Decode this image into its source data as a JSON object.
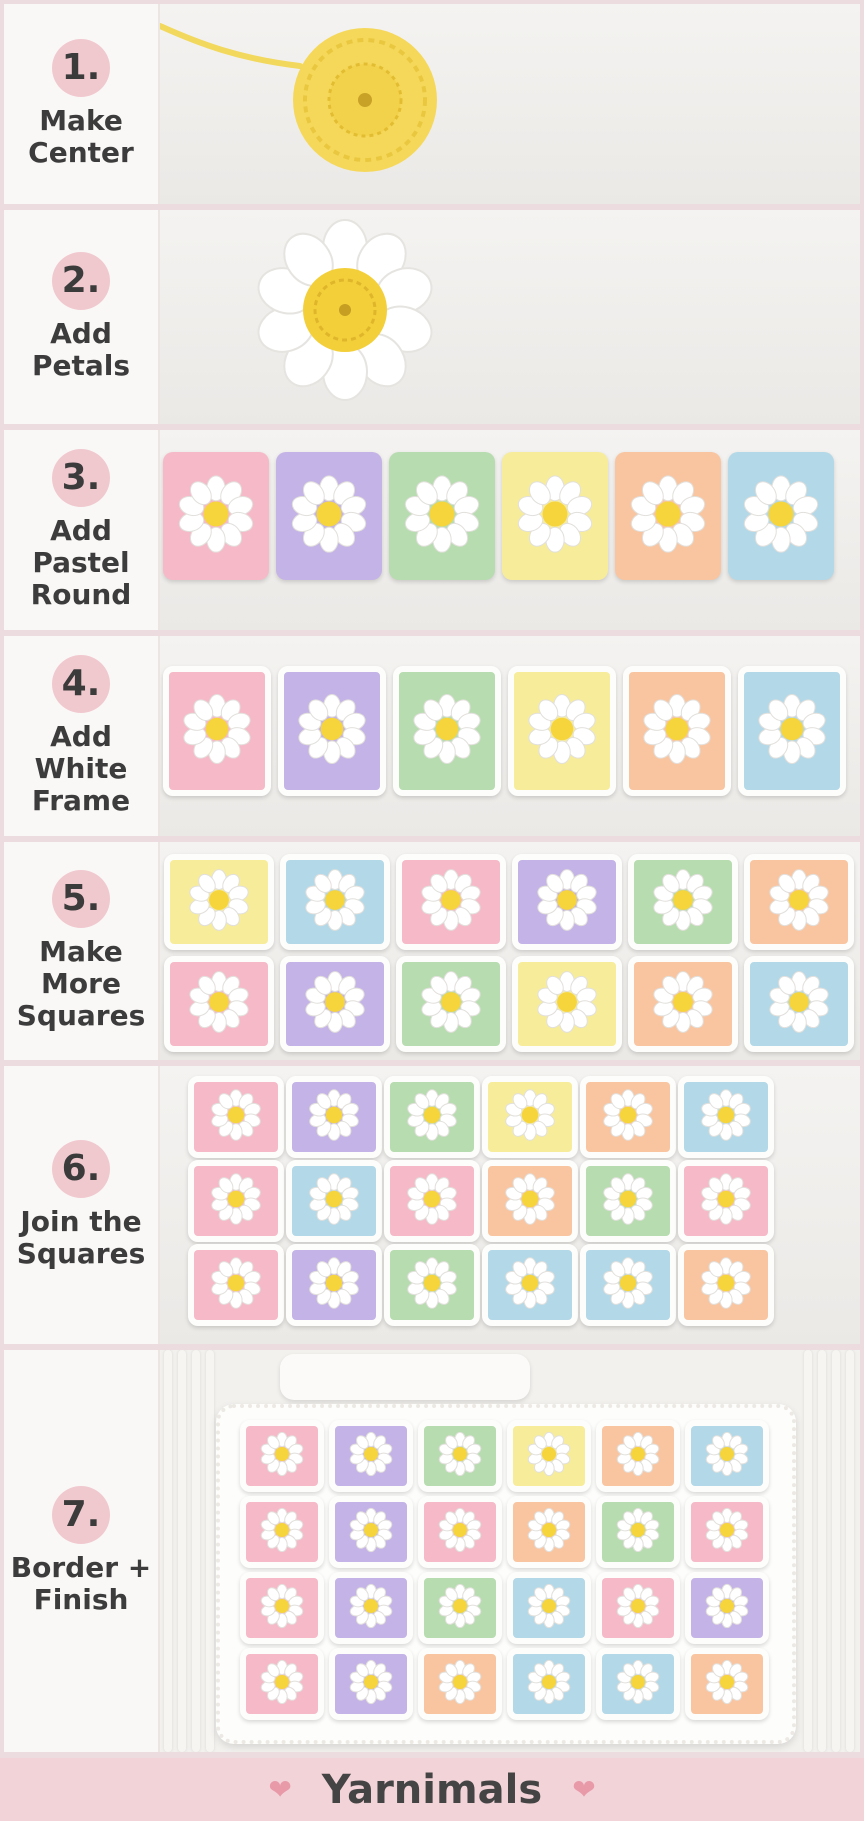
{
  "steps": [
    {
      "number": "1.",
      "title": "Make\nCenter"
    },
    {
      "number": "2.",
      "title": "Add\nPetals"
    },
    {
      "number": "3.",
      "title": "Add\nPastel\nRound"
    },
    {
      "number": "4.",
      "title": "Add\nWhite\nFrame"
    },
    {
      "number": "5.",
      "title": "Make\nMore\nSquares"
    },
    {
      "number": "6.",
      "title": "Join the\nSquares"
    },
    {
      "number": "7.",
      "title": "Border +\nFinish"
    }
  ],
  "brand": "Yarnimals",
  "colors": {
    "pink": "#f6b9c8",
    "lavender": "#c4b3e6",
    "mint": "#b7dcb0",
    "yellow": "#f7ec9a",
    "peach": "#f9c5a0",
    "blue": "#b3d8e8",
    "center": "#f5d43c",
    "petal": "#ffffff",
    "accent": "#f0c9cf"
  },
  "icons": {
    "heart": "heart-icon"
  },
  "rows": {
    "step3": [
      "pink",
      "lavender",
      "mint",
      "yellow",
      "peach",
      "blue"
    ],
    "step4": [
      "pink",
      "lavender",
      "mint",
      "yellow",
      "peach",
      "blue"
    ],
    "step5": [
      [
        "yellow",
        "blue",
        "pink",
        "lavender",
        "mint",
        "peach"
      ],
      [
        "pink",
        "lavender",
        "mint",
        "yellow",
        "peach",
        "blue"
      ]
    ],
    "step6": [
      [
        "pink",
        "lavender",
        "mint",
        "yellow",
        "peach",
        "blue"
      ],
      [
        "pink",
        "blue",
        "pink",
        "peach",
        "mint",
        "pink"
      ],
      [
        "pink",
        "lavender",
        "mint",
        "blue",
        "blue",
        "peach"
      ]
    ],
    "step7": [
      [
        "pink",
        "lavender",
        "mint",
        "yellow",
        "peach",
        "blue"
      ],
      [
        "pink",
        "lavender",
        "pink",
        "peach",
        "mint",
        "pink"
      ],
      [
        "pink",
        "lavender",
        "mint",
        "blue",
        "pink",
        "lavender"
      ],
      [
        "pink",
        "lavender",
        "peach",
        "blue",
        "blue",
        "peach"
      ]
    ]
  }
}
